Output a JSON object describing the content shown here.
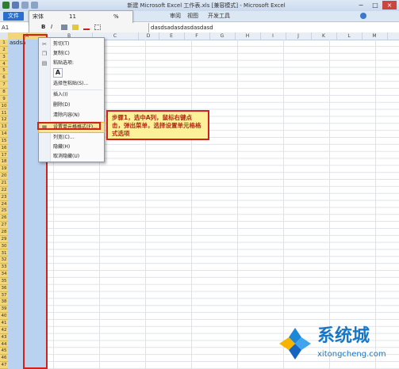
{
  "window": {
    "title": "新建 Microsoft Excel 工作表.xls [兼容模式] - Microsoft Excel",
    "min": "−",
    "max": "□",
    "close": "×"
  },
  "ribbon": {
    "tabs": [
      "文件",
      "审阅",
      "视图",
      "开发工具"
    ]
  },
  "mini_toolbar": {
    "font": "宋体",
    "size": "11",
    "percent": "%",
    "bold": "B",
    "italic": "I"
  },
  "formula_bar": {
    "name_box": "A1",
    "content": "dasdsadasdasdasdasd"
  },
  "columns": [
    "A",
    "B",
    "C",
    "D",
    "E",
    "F",
    "G",
    "H",
    "I",
    "J",
    "K",
    "L",
    "M"
  ],
  "rows": [
    "1",
    "2",
    "3",
    "4",
    "5",
    "6",
    "7",
    "8",
    "9",
    "10",
    "11",
    "12",
    "13",
    "14",
    "15",
    "16",
    "17",
    "18",
    "19",
    "20",
    "21",
    "22",
    "23",
    "24",
    "25",
    "26",
    "27",
    "28",
    "29",
    "30",
    "31",
    "32",
    "33",
    "34",
    "35",
    "36",
    "37",
    "38",
    "39",
    "40",
    "41",
    "42",
    "43",
    "44",
    "45",
    "46",
    "47"
  ],
  "cells": {
    "a1": "asdsa",
    "c1": "asd"
  },
  "context_menu": {
    "items": [
      {
        "label": "剪切(T)",
        "icon": "scissors-icon"
      },
      {
        "label": "复制(C)",
        "icon": "copy-icon"
      },
      {
        "label": "粘贴选项:",
        "icon": "paste-icon"
      },
      {
        "label": "选择性粘贴(S)...",
        "icon": ""
      },
      {
        "label": "插入(I)",
        "icon": ""
      },
      {
        "label": "删除(D)",
        "icon": ""
      },
      {
        "label": "清除内容(N)",
        "icon": ""
      },
      {
        "label": "设置单元格格式(F)...",
        "icon": "format-cells-icon"
      },
      {
        "label": "列宽(C)...",
        "icon": ""
      },
      {
        "label": "隐藏(H)",
        "icon": ""
      },
      {
        "label": "取消隐藏(U)",
        "icon": ""
      }
    ],
    "paste_option": "A"
  },
  "callout": {
    "text": "步骤1，选中A列，鼠标右键点击，弹出菜单，选择设置单元格格式选项"
  },
  "watermark": {
    "brand": "系统城",
    "url": "xitongcheng.com"
  },
  "colors": {
    "selection": "#b9d2ef",
    "row_header": "#f3d67a",
    "annotation_red": "#d2201b",
    "callout_bg": "#fcf099",
    "brand_blue": "#1677c8"
  }
}
